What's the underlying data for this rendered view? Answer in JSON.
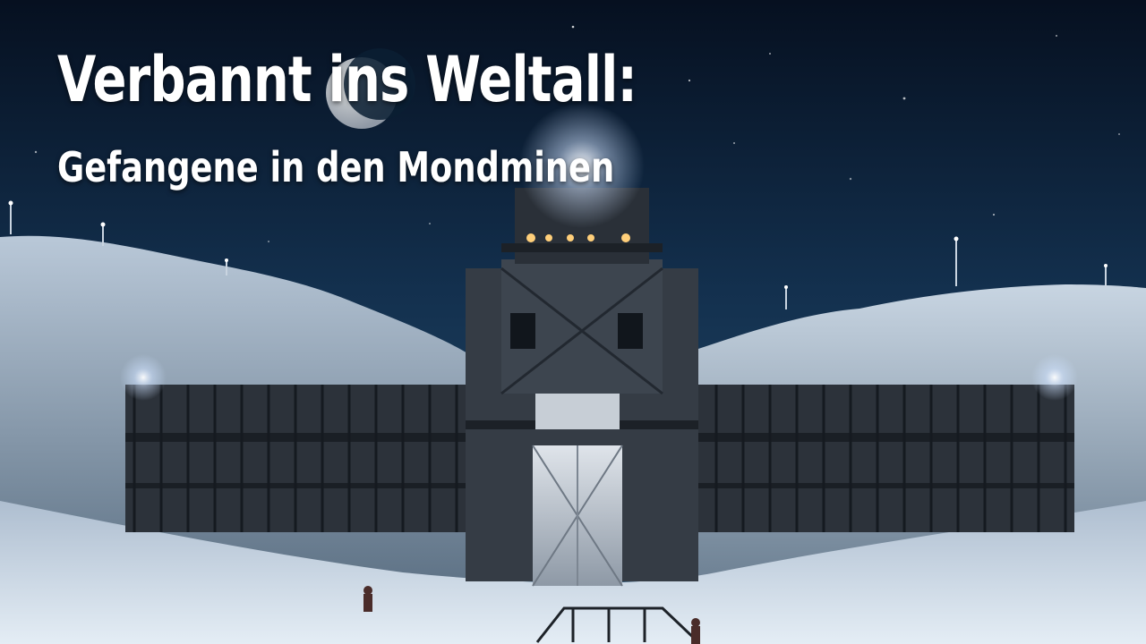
{
  "title": {
    "headline": "Verbannt ins Weltall:",
    "subline": "Gefangene in den Mondminen"
  },
  "colors": {
    "sky_top": "#061020",
    "sky_mid": "#163452",
    "snow": "#d7e3ef",
    "structure": "#2c323a",
    "light": "#fff6d8"
  }
}
